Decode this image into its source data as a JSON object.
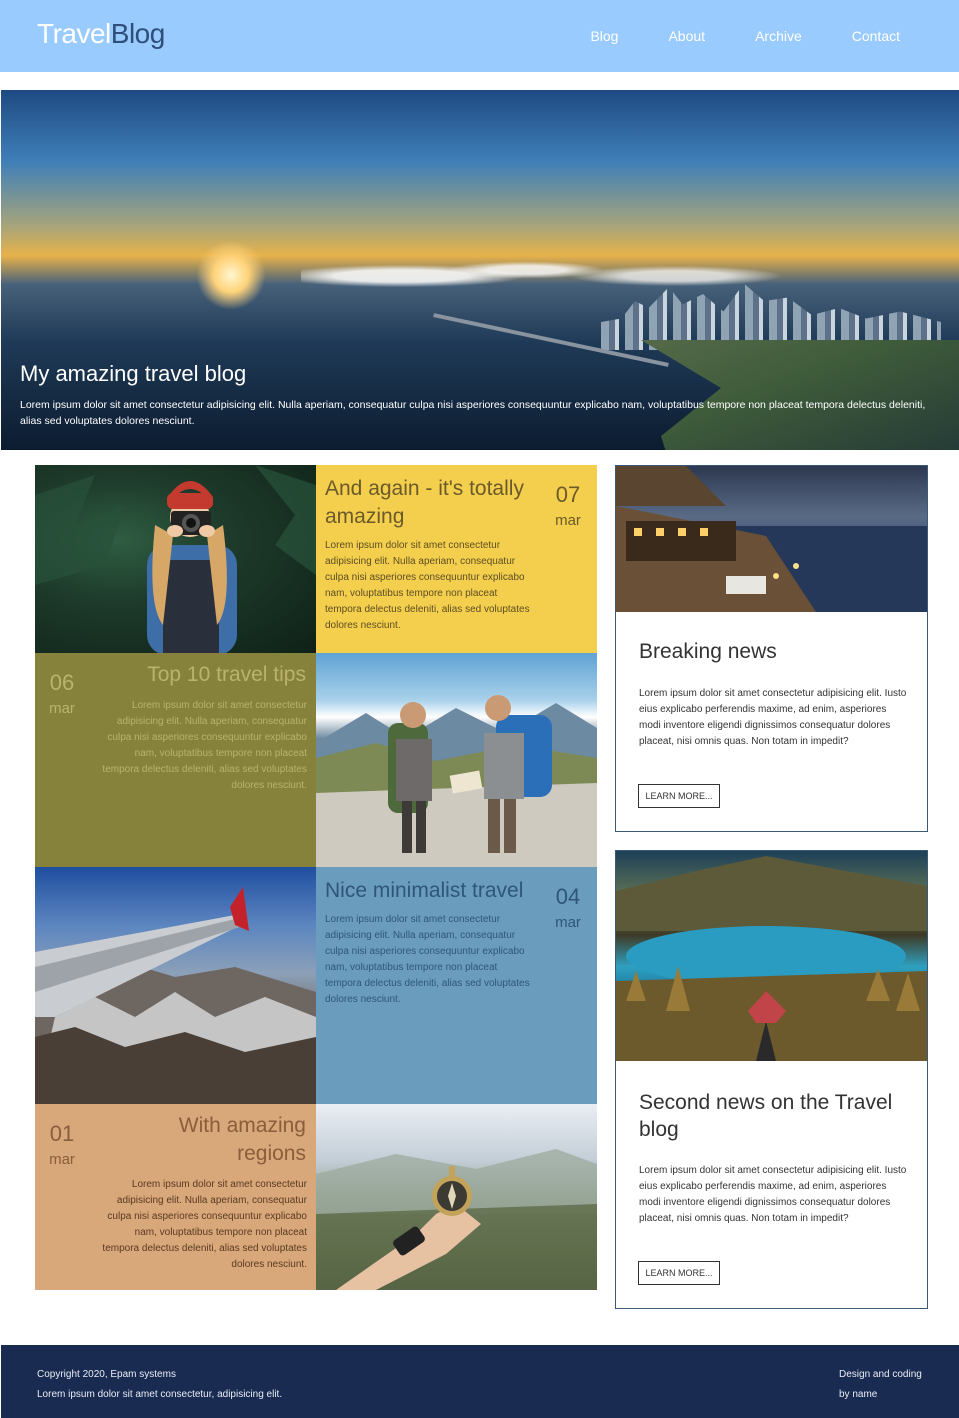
{
  "header": {
    "logo_part1": "Travel",
    "logo_part2": "Blog",
    "nav": [
      "Blog",
      "About",
      "Archive",
      "Contact"
    ]
  },
  "hero": {
    "title": "My amazing travel blog",
    "text": "Lorem ipsum dolor sit amet consectetur adipisicing elit. Nulla aperiam, consequatur culpa nisi asperiores consequuntur explicabo nam, voluptatibus tempore non placeat tempora delectus deleniti, alias sed voluptates dolores nesciunt."
  },
  "posts": [
    {
      "title": "And again - it's totally amazing",
      "day": "07",
      "month": "mar",
      "text": "Lorem ipsum dolor sit amet consectetur adipisicing elit. Nulla aperiam, consequatur culpa nisi asperiores consequuntur explicabo nam, voluptatibus tempore non placeat tempora delectus deleniti, alias sed voluptates dolores nesciunt.",
      "color": "#f4cf4d"
    },
    {
      "title": "Top 10 travel tips",
      "day": "06",
      "month": "mar",
      "text": "Lorem ipsum dolor sit amet consectetur adipisicing elit. Nulla aperiam, consequatur culpa nisi asperiores consequuntur explicabo nam, voluptatibus tempore non placeat tempora delectus deleniti, alias sed voluptates dolores nesciunt.",
      "color": "#86813b"
    },
    {
      "title": "Nice minimalist travel",
      "day": "04",
      "month": "mar",
      "text": "Lorem ipsum dolor sit amet consectetur adipisicing elit. Nulla aperiam, consequatur culpa nisi asperiores consequuntur explicabo nam, voluptatibus tempore non placeat tempora delectus deleniti, alias sed voluptates dolores nesciunt.",
      "color": "#6a9cbe"
    },
    {
      "title": "With amazing regions",
      "day": "01",
      "month": "mar",
      "text": "Lorem ipsum dolor sit amet consectetur adipisicing elit. Nulla aperiam, consequatur culpa nisi asperiores consequuntur explicabo nam, voluptatibus tempore non placeat tempora delectus deleniti, alias sed voluptates dolores nesciunt.",
      "color": "#d8a77a"
    }
  ],
  "news": [
    {
      "title": "Breaking news",
      "text": "Lorem ipsum dolor sit amet consectetur adipisicing elit. Iusto eius explicabo perferendis maxime, ad enim, asperiores modi inventore eligendi dignissimos consequatur dolores placeat, nisi omnis quas. Non totam in impedit?",
      "button": "LEARN MORE..."
    },
    {
      "title": "Second news on the Travel blog",
      "text": "Lorem ipsum dolor sit amet consectetur adipisicing elit. Iusto eius explicabo perferendis maxime, ad enim, asperiores modi inventore eligendi dignissimos consequatur dolores placeat, nisi omnis quas. Non totam in impedit?",
      "button": "LEARN MORE..."
    }
  ],
  "footer": {
    "copyright": "Copyright 2020, Epam systems",
    "text": "Lorem ipsum dolor sit amet consectetur, adipisicing elit.",
    "credit_line1": "Design and coding",
    "credit_line2": "by name"
  },
  "colors": {
    "header_bg": "#99cbff",
    "logo_accent": "#2e4f7a",
    "footer_bg": "#1a2b52"
  }
}
